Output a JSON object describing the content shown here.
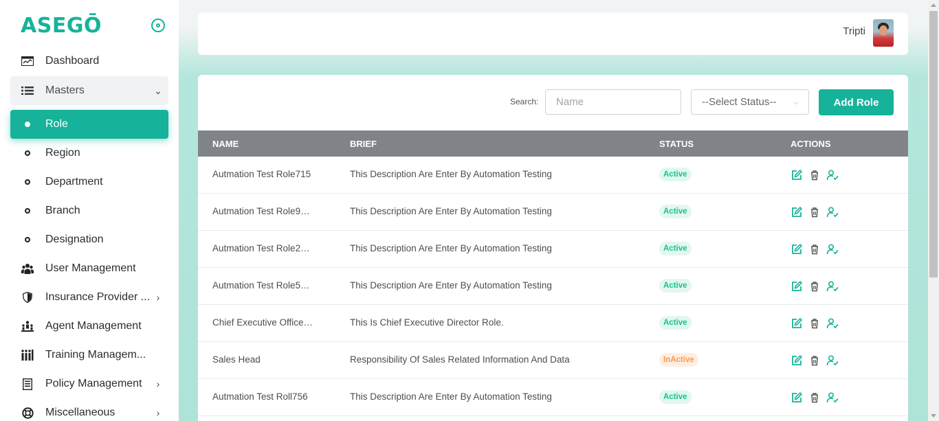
{
  "brand": {
    "name": "ASEGŌ"
  },
  "sidebar": {
    "items": [
      {
        "label": "Dashboard",
        "icon": "dashboard-icon"
      },
      {
        "label": "Masters",
        "icon": "list-icon",
        "expanded": true
      },
      {
        "label": "Role",
        "icon": "bullet-icon",
        "active": true
      },
      {
        "label": "Region",
        "icon": "bullet-icon"
      },
      {
        "label": "Department",
        "icon": "bullet-icon"
      },
      {
        "label": "Branch",
        "icon": "bullet-icon"
      },
      {
        "label": "Designation",
        "icon": "bullet-icon"
      },
      {
        "label": "User Management",
        "icon": "users-icon"
      },
      {
        "label": "Insurance Provider ...",
        "icon": "shield-icon"
      },
      {
        "label": "Agent Management",
        "icon": "agents-icon"
      },
      {
        "label": "Training Managem...",
        "icon": "training-icon"
      },
      {
        "label": "Policy Management",
        "icon": "document-icon"
      },
      {
        "label": "Miscellaneous",
        "icon": "lifebuoy-icon"
      }
    ]
  },
  "header": {
    "username": "Tripti"
  },
  "toolbar": {
    "search_label": "Search:",
    "search_placeholder": "Name",
    "status_placeholder": "--Select Status--",
    "add_label": "Add Role"
  },
  "table": {
    "columns": [
      "NAME",
      "BRIEF",
      "STATUS",
      "ACTIONS"
    ],
    "rows": [
      {
        "name": "Autmation Test Role715",
        "brief": "This Description Are Enter By Automation Testing",
        "status": "Active"
      },
      {
        "name": "Autmation Test Role9…",
        "brief": "This Description Are Enter By Automation Testing",
        "status": "Active"
      },
      {
        "name": "Autmation Test Role2…",
        "brief": "This Description Are Enter By Automation Testing",
        "status": "Active"
      },
      {
        "name": "Autmation Test Role5…",
        "brief": "This Description Are Enter By Automation Testing",
        "status": "Active"
      },
      {
        "name": "Chief Executive Office…",
        "brief": "This Is Chief Executive Director Role.",
        "status": "Active"
      },
      {
        "name": "Sales Head",
        "brief": "Responsibility Of Sales Related Information And Data",
        "status": "InActive"
      },
      {
        "name": "Autmation Test Roll756",
        "brief": "This Description Are Enter By Automation Testing",
        "status": "Active"
      }
    ]
  },
  "colors": {
    "accent": "#16b39a",
    "header": "#808489",
    "active_text": "#18c38c",
    "inactive_text": "#f59a4f"
  }
}
